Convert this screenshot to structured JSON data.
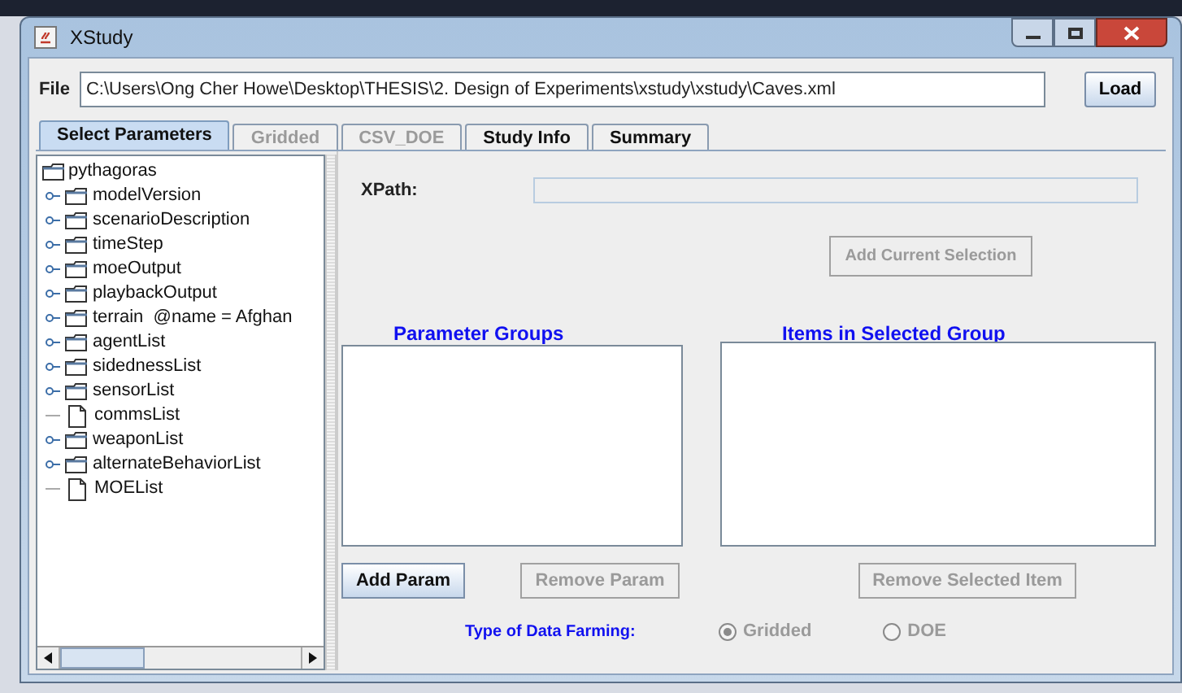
{
  "window": {
    "title": "XStudy"
  },
  "file": {
    "label": "File",
    "value": "C:\\Users\\Ong Cher Howe\\Desktop\\THESIS\\2. Design of Experiments\\xstudy\\xstudy\\Caves.xml",
    "button": "Load"
  },
  "tabs": [
    {
      "label": "Select Parameters",
      "selected": true,
      "disabled": false
    },
    {
      "label": "Gridded",
      "selected": false,
      "disabled": true
    },
    {
      "label": "CSV_DOE",
      "selected": false,
      "disabled": true
    },
    {
      "label": "Study Info",
      "selected": false,
      "disabled": false
    },
    {
      "label": "Summary",
      "selected": false,
      "disabled": false
    }
  ],
  "tree": {
    "label": "pythagoras",
    "children": [
      {
        "label": "modelVersion",
        "kind": "folder"
      },
      {
        "label": "scenarioDescription",
        "kind": "folder"
      },
      {
        "label": "timeStep",
        "kind": "folder"
      },
      {
        "label": "moeOutput",
        "kind": "folder"
      },
      {
        "label": "playbackOutput",
        "kind": "folder"
      },
      {
        "label": "terrain  @name = Afghan",
        "kind": "folder"
      },
      {
        "label": "agentList",
        "kind": "folder"
      },
      {
        "label": "sidednessList",
        "kind": "folder"
      },
      {
        "label": "sensorList",
        "kind": "folder"
      },
      {
        "label": "commsList",
        "kind": "leaf"
      },
      {
        "label": "weaponList",
        "kind": "folder"
      },
      {
        "label": "alternateBehaviorList",
        "kind": "folder"
      },
      {
        "label": "MOEList",
        "kind": "leaf"
      }
    ]
  },
  "xpath": {
    "label": "XPath:",
    "disabled": true
  },
  "add_selection_button": {
    "label": "Add Current Selection",
    "disabled": true
  },
  "parameter_groups": {
    "heading": "Parameter Groups",
    "buttons": [
      {
        "label": "Add Param",
        "disabled": false
      },
      {
        "label": "Remove Param",
        "disabled": true
      }
    ]
  },
  "selected_group_items": {
    "heading": "Items in Selected Group",
    "buttons": [
      {
        "label": "Remove Selected Item",
        "disabled": true
      }
    ]
  },
  "data_farming": {
    "label": "Type of Data Farming:",
    "options": [
      {
        "label": "Gridded",
        "selected": true,
        "disabled": true
      },
      {
        "label": "DOE",
        "selected": false,
        "disabled": true
      }
    ]
  }
}
